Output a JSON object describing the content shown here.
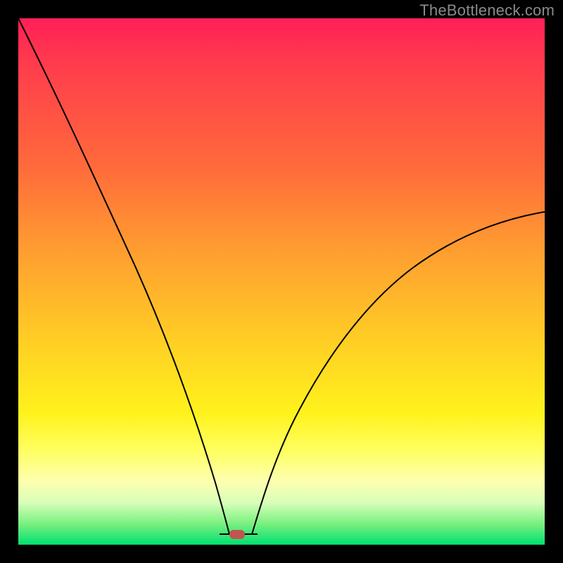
{
  "watermark": "TheBottleneck.com",
  "chart_data": {
    "type": "line",
    "title": "",
    "xlabel": "",
    "ylabel": "",
    "xlim": [
      0,
      100
    ],
    "ylim": [
      0,
      100
    ],
    "grid": false,
    "legend": false,
    "series": [
      {
        "name": "bottleneck-curve",
        "x": [
          0,
          5,
          10,
          15,
          20,
          25,
          30,
          35,
          38,
          40,
          42,
          45,
          50,
          55,
          60,
          65,
          70,
          75,
          80,
          85,
          90,
          95,
          100
        ],
        "values": [
          100,
          89,
          78,
          67,
          56,
          45,
          34,
          22,
          10,
          2,
          2,
          2,
          9,
          16,
          23,
          29,
          35,
          40,
          45,
          49,
          53,
          56,
          59
        ]
      }
    ],
    "flat_segment": {
      "x_start": 38,
      "x_end": 45,
      "y": 2
    },
    "marker": {
      "x": 41,
      "y": 2,
      "color": "#c0554d"
    },
    "background": {
      "type": "vertical-gradient",
      "stops": [
        {
          "pos": 0.0,
          "color": "#ff1f57"
        },
        {
          "pos": 0.28,
          "color": "#ff6a3b"
        },
        {
          "pos": 0.62,
          "color": "#ffd024"
        },
        {
          "pos": 0.88,
          "color": "#fdffb0"
        },
        {
          "pos": 1.0,
          "color": "#00e070"
        }
      ]
    }
  }
}
